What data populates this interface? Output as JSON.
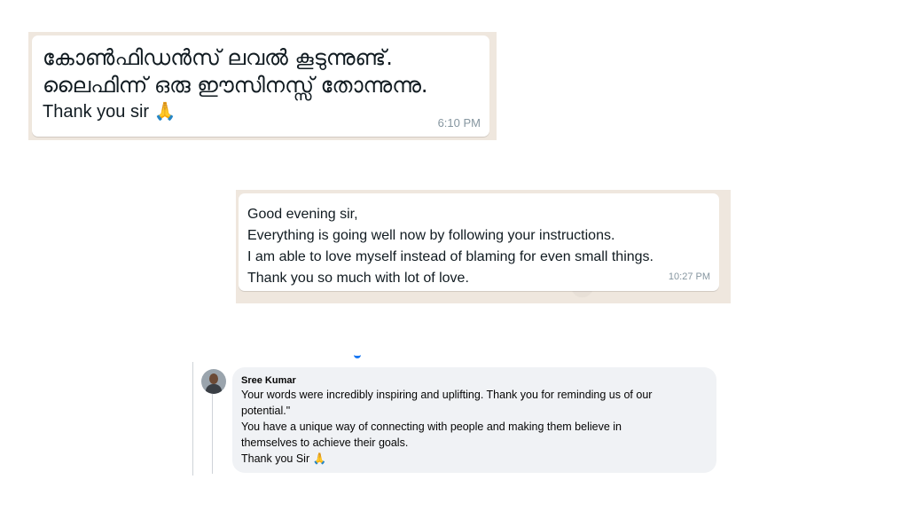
{
  "chat1": {
    "lines": [
      "കോൺഫിഡൻസ് ലവൽ കൂടുന്നുണ്ട്.",
      "ലൈഫിന്ന് ഒരു ഈസിനസ്സ് തോന്നുന്നു."
    ],
    "thanks": "Thank you sir 🙏",
    "time": "6:10 PM"
  },
  "chat2": {
    "lines": [
      "Good evening sir,",
      "Everything is going well now by following your instructions.",
      "I am able to love myself instead of blaming for even small things.",
      "Thank you so much with lot of love."
    ],
    "time": "10:27 PM"
  },
  "comment": {
    "author": "Sree Kumar",
    "lines": [
      "Your words were incredibly inspiring and uplifting. Thank you for reminding us of our",
      "potential.\"",
      "You have a unique way of connecting with people and making them believe in",
      "themselves to achieve their goals.",
      "Thank you Sir 🙏"
    ]
  },
  "colors": {
    "chat_background": "#efe7de",
    "bubble": "#ffffff",
    "timestamp": "#8696a0",
    "comment_bubble": "#f0f2f5",
    "facebook_accent": "#1877f2"
  },
  "icons": {
    "avatar": "profile-photo",
    "thanks_emoji": "folded-hands"
  }
}
